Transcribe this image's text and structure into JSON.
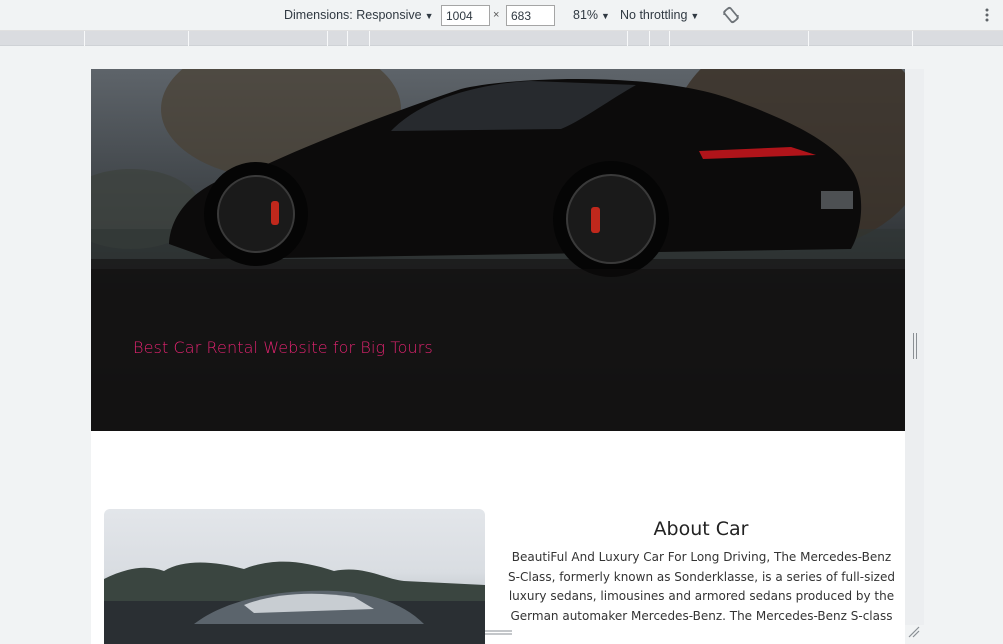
{
  "devtools": {
    "dimensions_label": "Dimensions: Responsive",
    "width_value": "1004",
    "times": "×",
    "height_value": "683",
    "zoom": "81%",
    "throttling": "No throttling"
  },
  "icons": {
    "dropdown": "chevron-down-icon",
    "rotate": "rotate-icon",
    "more": "more-vertical-icon"
  },
  "hero": {
    "tagline": "Best Car Rental Website for Big Tours"
  },
  "about": {
    "title": "About Car",
    "text": "BeautiFul And Luxury Car For Long Driving, The Mercedes-Benz S-Class, formerly known as Sonderklasse, is a series of full-sized luxury sedans, limousines and armored sedans produced by the German automaker Mercedes-Benz. The Mercedes-Benz S-class"
  },
  "colors": {
    "accent": "#e0236f",
    "toolbar_bg": "#f1f3f4"
  }
}
